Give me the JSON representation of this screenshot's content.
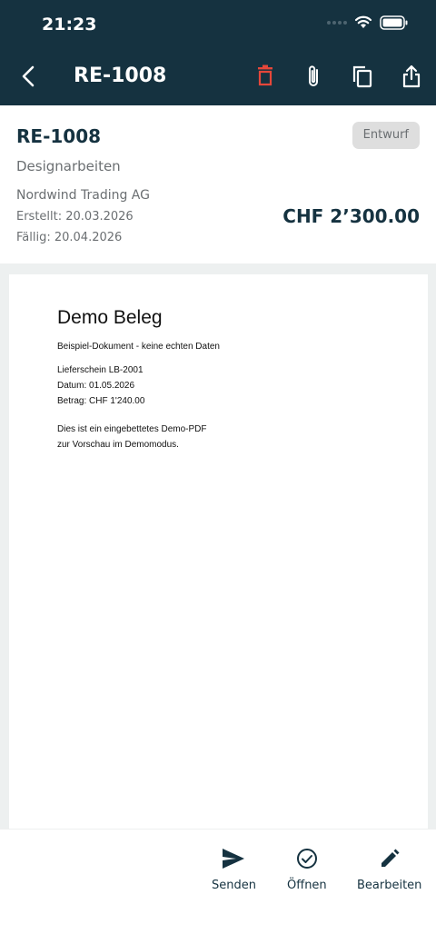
{
  "status_bar": {
    "time": "21:23"
  },
  "header": {
    "title": "RE-1008"
  },
  "invoice": {
    "number": "RE-1008",
    "status": "Entwurf",
    "description": "Designarbeiten",
    "customer": "Nordwind Trading AG",
    "created": "Erstellt: 20.03.2026",
    "due": "Fällig: 20.04.2026",
    "amount": "CHF  2’300.00"
  },
  "document": {
    "heading": "Demo Beleg",
    "subtitle": "Beispiel-Dokument - keine echten Daten",
    "lines": [
      "Lieferschein LB-2001",
      "Datum: 01.05.2026",
      "Betrag: CHF 1'240.00"
    ],
    "note": [
      "Dies ist ein eingebettetes Demo-PDF",
      "zur Vorschau im Demomodus."
    ]
  },
  "actions": {
    "send": "Senden",
    "open": "Öffnen",
    "edit": "Bearbeiten"
  },
  "colors": {
    "header_bg": "#153240",
    "delete": "#e5473a",
    "badge_bg": "#dedede"
  }
}
